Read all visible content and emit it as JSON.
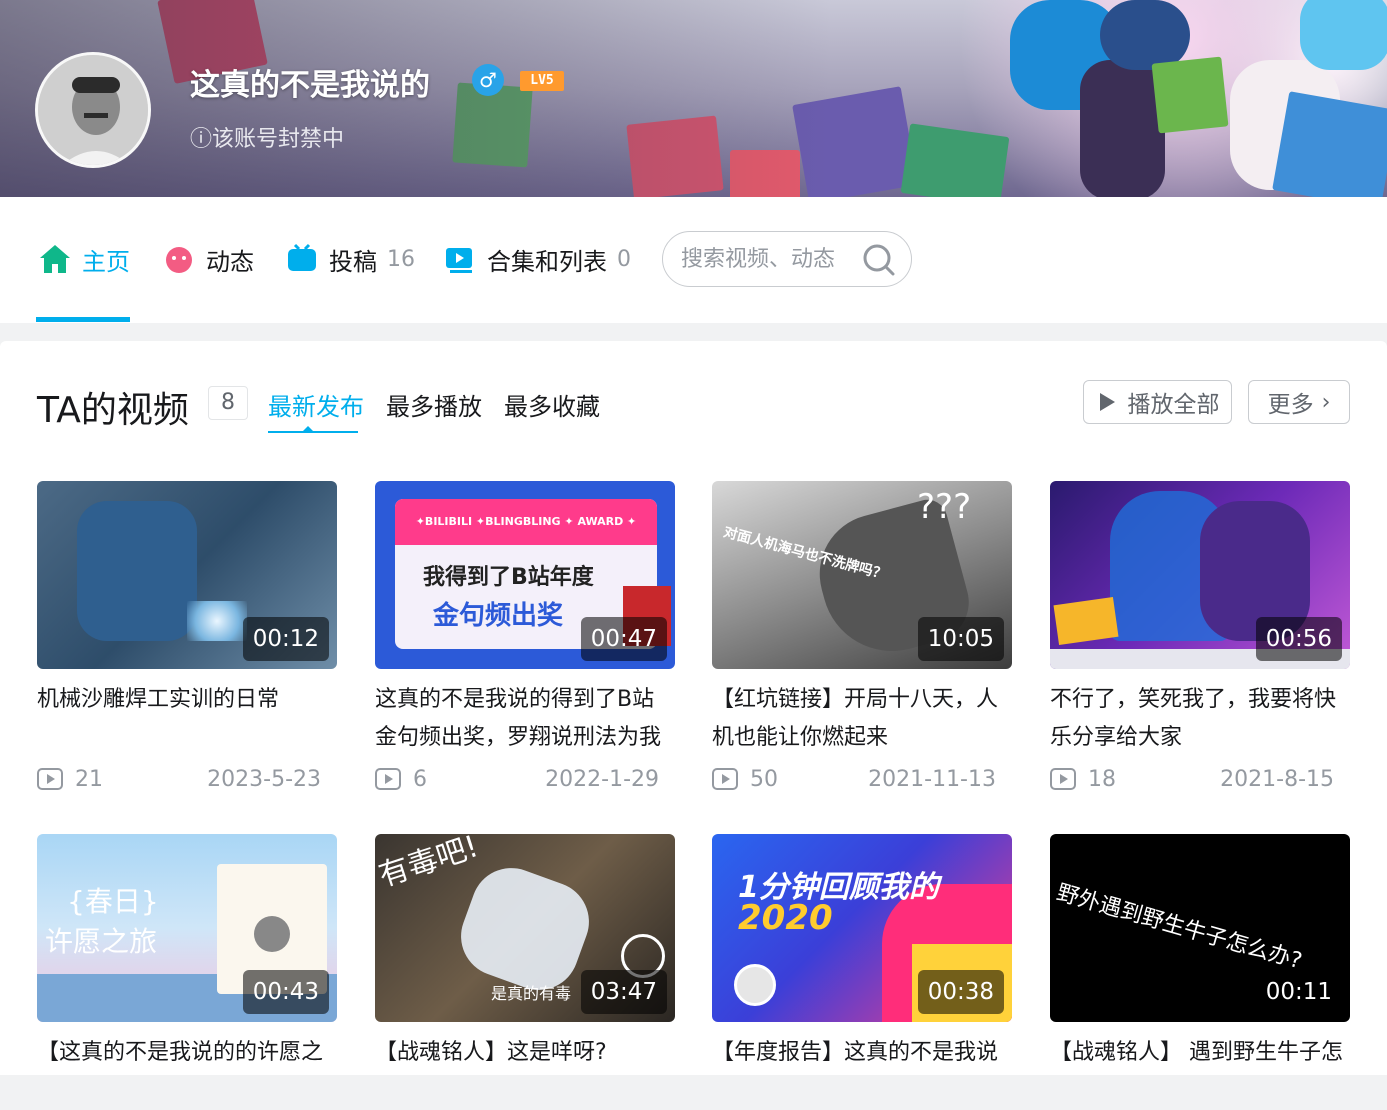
{
  "profile": {
    "username": "这真的不是我说的",
    "gender_icon": "♂",
    "level": "LV5",
    "status": "ⓘ该账号封禁中"
  },
  "nav": {
    "home": "主页",
    "dynamic": "动态",
    "uploads": "投稿",
    "uploads_count": "16",
    "collections": "合集和列表",
    "collections_count": "0",
    "search_placeholder": "搜索视频、动态"
  },
  "section": {
    "title": "TA的视频",
    "count": "8",
    "tabs": [
      "最新发布",
      "最多播放",
      "最多收藏"
    ],
    "play_all": "播放全部",
    "more": "更多"
  },
  "videos": [
    {
      "title": "机械沙雕焊工实训的日常",
      "duration": "00:12",
      "plays": "21",
      "date": "2023-5-23"
    },
    {
      "title": "这真的不是我说的得到了B站金句频出奖，罗翔说刑法为我",
      "duration": "00:47",
      "plays": "6",
      "date": "2022-1-29",
      "overlay": {
        "banner": "✦BILIBILI ✦BLINGBLING ✦ AWARD ✦",
        "line1": "我得到了B站年度",
        "line2": "金句频出奖"
      }
    },
    {
      "title": "【红坑链接】开局十八天，人机也能让你燃起来",
      "duration": "10:05",
      "plays": "50",
      "date": "2021-11-13",
      "overlay": {
        "line1": "对面人机海马也不洗牌吗？",
        "line2": "???"
      }
    },
    {
      "title": "不行了，笑死我了，我要将快乐分享给大家",
      "duration": "00:56",
      "plays": "18",
      "date": "2021-8-15"
    },
    {
      "title": "【这真的不是我说的的许愿之",
      "duration": "00:43",
      "overlay": {
        "line1": "{春日}",
        "line2": "许愿之旅"
      }
    },
    {
      "title": "【战魂铭人】这是咩呀?",
      "duration": "03:47",
      "overlay": {
        "line1": "有毒吧!",
        "line2": "是真的有毒"
      }
    },
    {
      "title": "【年度报告】这真的不是我说",
      "duration": "00:38",
      "overlay": {
        "line1": "1分钟回顾我的",
        "line2": "2020"
      }
    },
    {
      "title": "【战魂铭人】 遇到野生牛子怎",
      "duration": "00:11",
      "overlay": {
        "line1": "野外遇到野生牛子怎么办?"
      }
    }
  ],
  "colors": {
    "accent": "#00aeec",
    "text": "#18191c",
    "muted": "#9499a0"
  }
}
